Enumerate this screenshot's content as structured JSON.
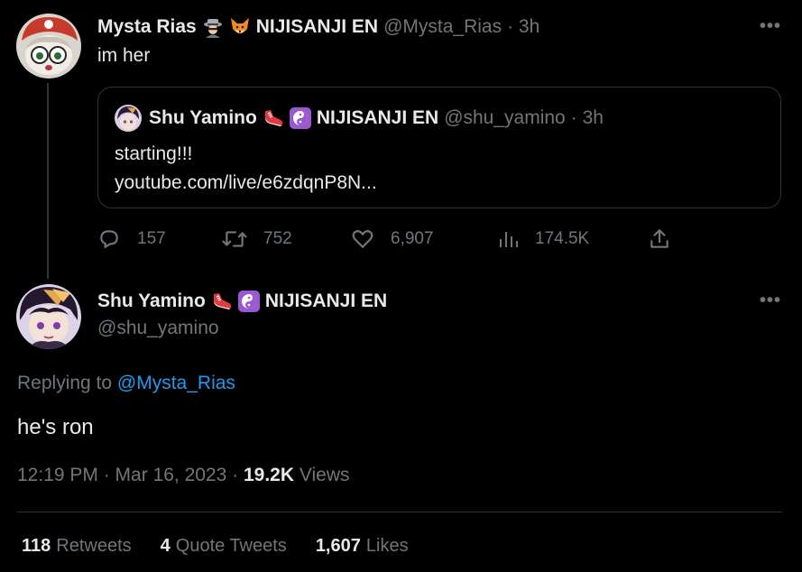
{
  "colors": {
    "background": "#000000",
    "text_primary": "#e7e9ea",
    "text_secondary": "#71767b",
    "link": "#1d9bf0",
    "border": "#2f3336"
  },
  "tweet": {
    "author_name": "Mysta Rias",
    "author_emojis": [
      "detective-icon",
      "fox-icon"
    ],
    "author_affiliation": "NIJISANJI EN",
    "handle": "@Mysta_Rias",
    "time": "· 3h",
    "text": "im her",
    "more": "•••",
    "quote": {
      "author_name": "Shu Yamino",
      "author_emojis": [
        "sneaker-icon",
        "yin-yang-icon"
      ],
      "author_affiliation": "NIJISANJI EN",
      "handle": "@shu_yamino",
      "time": "· 3h",
      "text_line1": "starting!!!",
      "text_line2": "youtube.com/live/e6zdqnP8N..."
    },
    "actions": {
      "replies": "157",
      "retweets": "752",
      "likes": "6,907",
      "views": "174.5K"
    }
  },
  "reply": {
    "author_name": "Shu Yamino",
    "author_emojis": [
      "sneaker-icon",
      "yin-yang-icon"
    ],
    "author_affiliation": "NIJISANJI EN",
    "handle": "@shu_yamino",
    "more": "•••",
    "replying_prefix": "Replying to",
    "replying_handle": "@Mysta_Rias",
    "text": "he's ron",
    "timestamp": "12:19 PM · Mar 16, 2023 ·",
    "views_count": "19.2K",
    "views_label": "Views",
    "stats": {
      "retweets_count": "118",
      "retweets_label": "Retweets",
      "quotes_count": "4",
      "quotes_label": "Quote Tweets",
      "likes_count": "1,607",
      "likes_label": "Likes"
    }
  }
}
